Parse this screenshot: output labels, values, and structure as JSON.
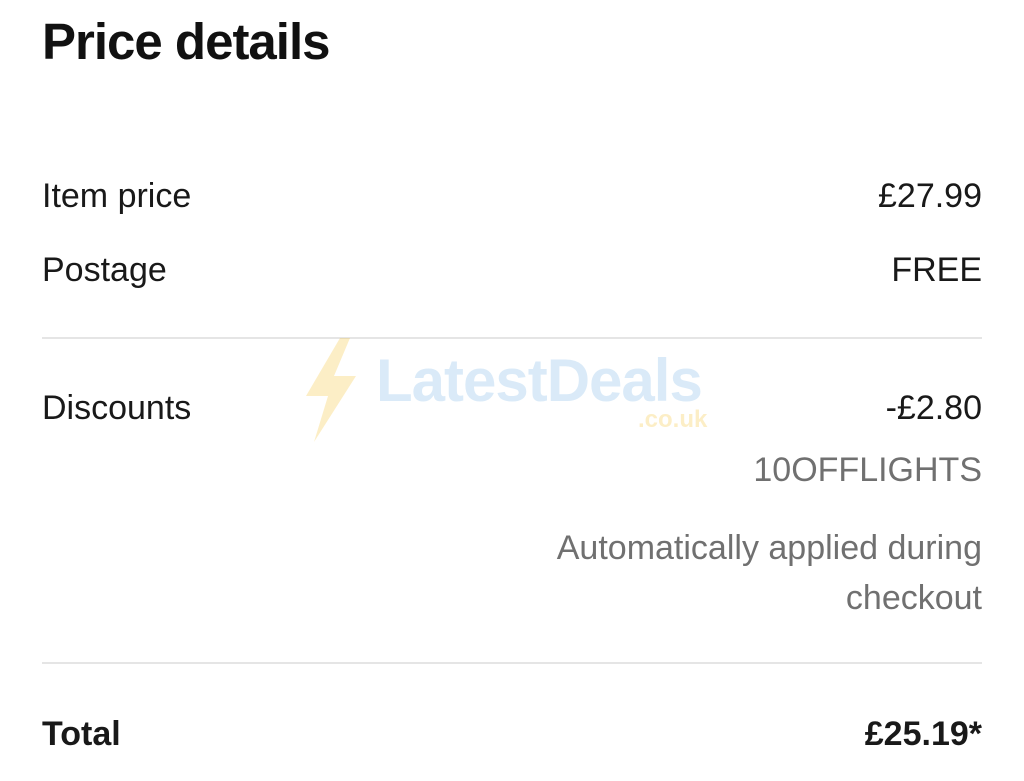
{
  "header": {
    "title": "Price details"
  },
  "rows": {
    "item_price": {
      "label": "Item price",
      "value": "£27.99"
    },
    "postage": {
      "label": "Postage",
      "value": "FREE"
    },
    "discounts": {
      "label": "Discounts",
      "value": "-£2.80",
      "code": "10OFFLIGHTS",
      "note": "Automatically applied during checkout"
    },
    "total": {
      "label": "Total",
      "value": "£25.19*"
    }
  },
  "watermark": {
    "name": "LatestDeals",
    "domain": ".co.uk",
    "icon": "lightning-bolt-icon"
  },
  "colors": {
    "text": "#191919",
    "muted": "#707070",
    "divider": "#e5e5e5",
    "watermark_blue": "#5aa4e0",
    "watermark_yellow": "#f4b400"
  }
}
